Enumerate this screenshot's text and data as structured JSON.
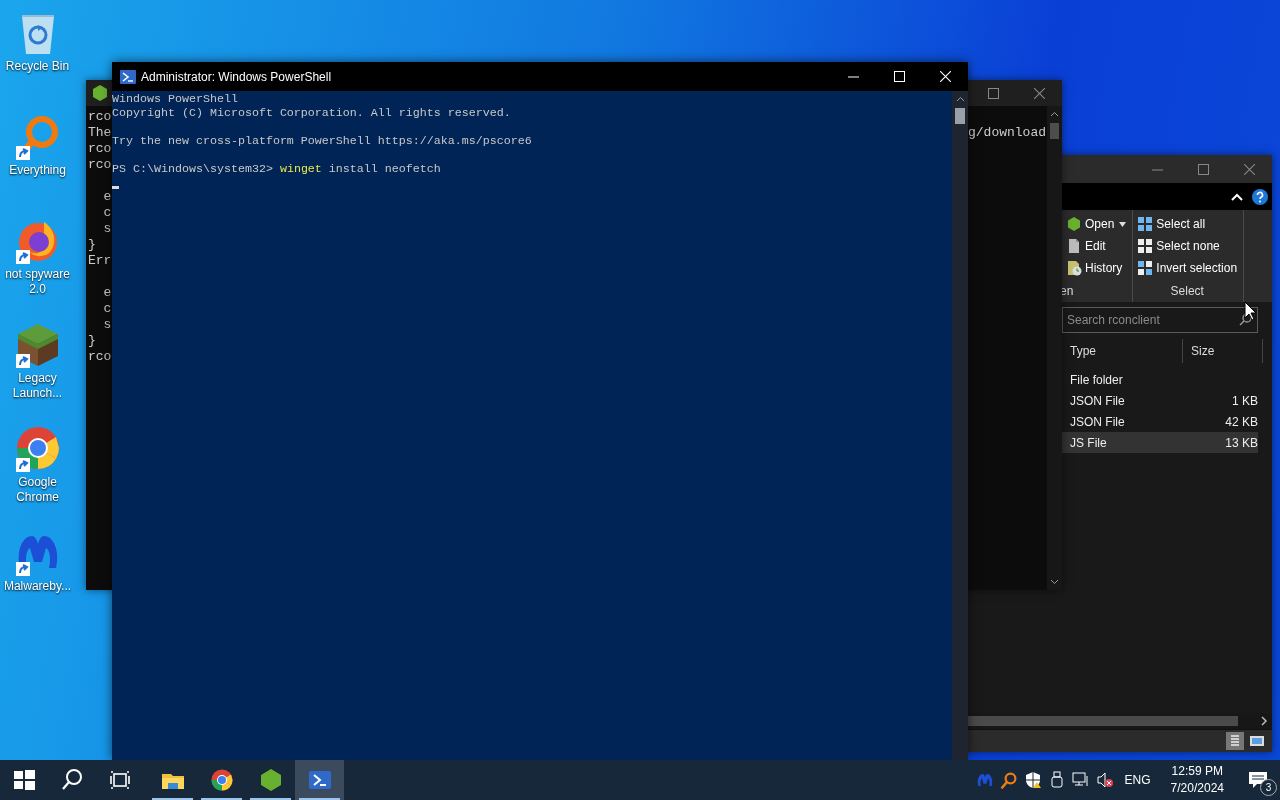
{
  "desktop_icons": [
    {
      "label": "Recycle Bin",
      "kind": "recycle",
      "shortcut": false
    },
    {
      "label": "Everything",
      "kind": "everything",
      "shortcut": true
    },
    {
      "label": "not spyware 2.0",
      "kind": "firefox",
      "shortcut": true
    },
    {
      "label": "Legacy Launch...",
      "kind": "block",
      "shortcut": true
    },
    {
      "label": "Google Chrome",
      "kind": "chrome",
      "shortcut": true
    },
    {
      "label": "Malwareby...",
      "kind": "malware",
      "shortcut": true
    }
  ],
  "back_console": {
    "blocks": [
      [
        "rco",
        "The",
        "rco",
        "rco"
      ],
      [
        "  e",
        "  c",
        "  s",
        "}",
        "Err"
      ],
      [
        "  e",
        "  c",
        "  s",
        "}",
        "rco"
      ]
    ],
    "fragment": "g/download"
  },
  "explorer": {
    "ribbon": {
      "groups": [
        {
          "label": "en",
          "items": [
            {
              "label": "Open",
              "kind": "open",
              "dropdown": true
            },
            {
              "label": "Edit",
              "kind": "edit",
              "dropdown": false
            },
            {
              "label": "History",
              "kind": "history",
              "dropdown": false
            }
          ]
        },
        {
          "label": "Select",
          "items": [
            {
              "label": "Select all",
              "kind": "all",
              "dropdown": false
            },
            {
              "label": "Select none",
              "kind": "none",
              "dropdown": false
            },
            {
              "label": "Invert selection",
              "kind": "invert",
              "dropdown": false
            }
          ]
        }
      ]
    },
    "search": {
      "placeholder": "Search rconclient"
    },
    "columns": [
      "Type",
      "Size"
    ],
    "rows": [
      {
        "type": "File folder",
        "selected": false
      },
      {
        "type": "JSON File",
        "size": "1 KB",
        "selected": false
      },
      {
        "type": "JSON File",
        "size": "42 KB",
        "selected": false
      },
      {
        "type": "JS File",
        "size": "13 KB",
        "selected": true
      }
    ]
  },
  "powershell": {
    "title": "Administrator: Windows PowerShell",
    "blocks": [
      [
        {
          "kind": "text",
          "text": "Windows PowerShell"
        },
        {
          "kind": "text",
          "text": "Copyright (C) Microsoft Corporation. All rights reserved."
        }
      ],
      [
        {
          "kind": "text",
          "text": "Try the new cross-platform PowerShell https://aka.ms/pscore6"
        }
      ],
      [
        {
          "kind": "prompt",
          "prompt": "PS C:\\Windows\\system32>",
          "command": "winget",
          "args": "install neofetch"
        }
      ]
    ],
    "cursor": true
  },
  "taskbar": {
    "buttons": [
      {
        "kind": "start"
      },
      {
        "kind": "search"
      },
      {
        "kind": "taskview"
      }
    ],
    "apps": [
      {
        "kind": "explorer",
        "running": true,
        "selected": false
      },
      {
        "kind": "chrome",
        "running": true,
        "selected": false
      },
      {
        "kind": "node",
        "running": true,
        "selected": false
      },
      {
        "kind": "powershell",
        "running": true,
        "selected": true
      }
    ],
    "tray": {
      "icons": [
        {
          "kind": "malware"
        },
        {
          "kind": "everything"
        },
        {
          "kind": "security"
        },
        {
          "kind": "usb"
        },
        {
          "kind": "network"
        },
        {
          "kind": "mute"
        }
      ],
      "language": "ENG",
      "time": "12:59 PM",
      "date": "7/20/2024",
      "notifications": "3"
    }
  }
}
